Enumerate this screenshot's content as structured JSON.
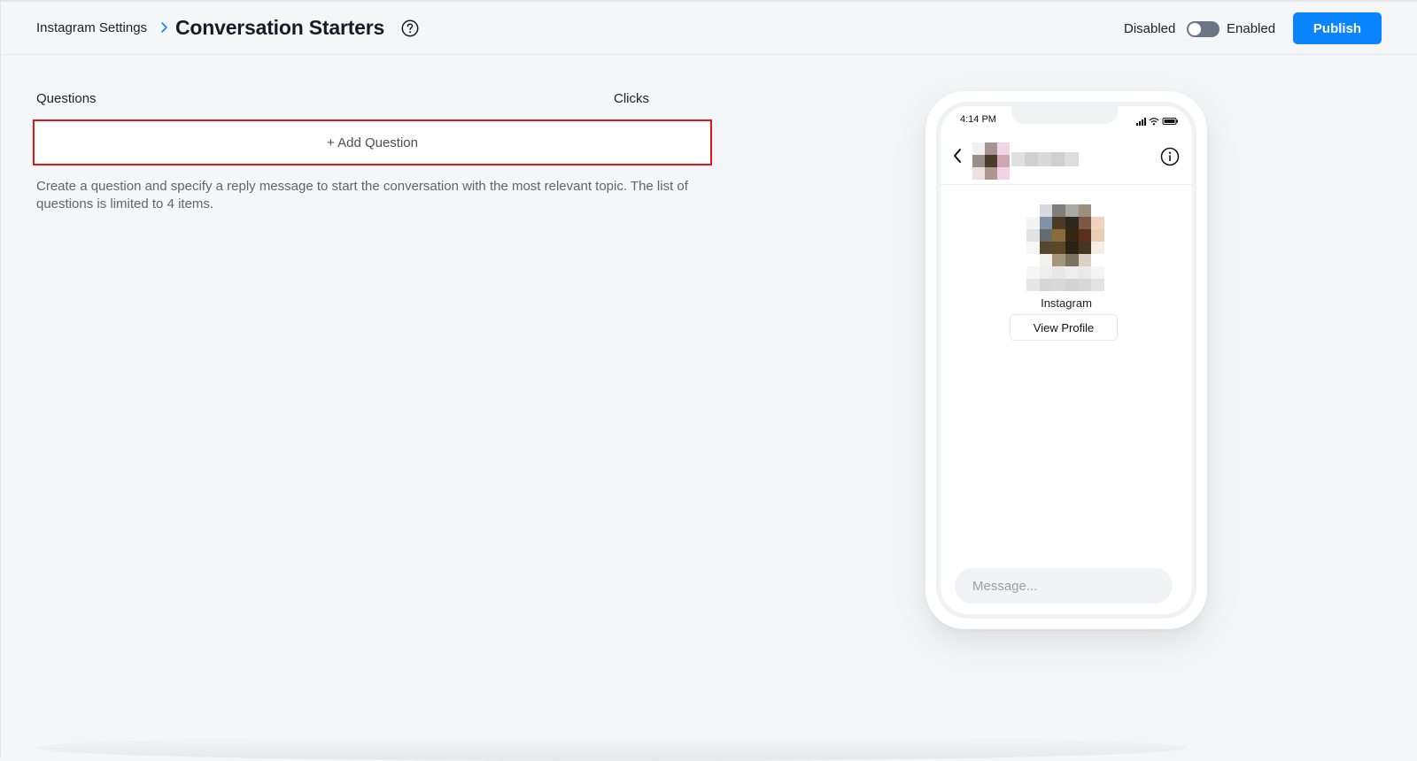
{
  "header": {
    "breadcrumb": "Instagram Settings",
    "title": "Conversation Starters",
    "toggle": {
      "off_label": "Disabled",
      "on_label": "Enabled",
      "state": "off"
    },
    "publish_label": "Publish"
  },
  "questions": {
    "column_questions": "Questions",
    "column_clicks": "Clicks",
    "add_label": "+ Add Question",
    "helper_text": "Create a question and specify a reply message to start the conversation with the most relevant topic. The list of questions is limited to 4 items."
  },
  "preview": {
    "status_time": "4:14 PM",
    "profile_name": "Instagram",
    "view_profile_label": "View Profile",
    "message_placeholder": "Message..."
  },
  "colors": {
    "accent": "#0a84ff",
    "highlight_border": "#e0161b",
    "background": "#f5f6f8"
  }
}
